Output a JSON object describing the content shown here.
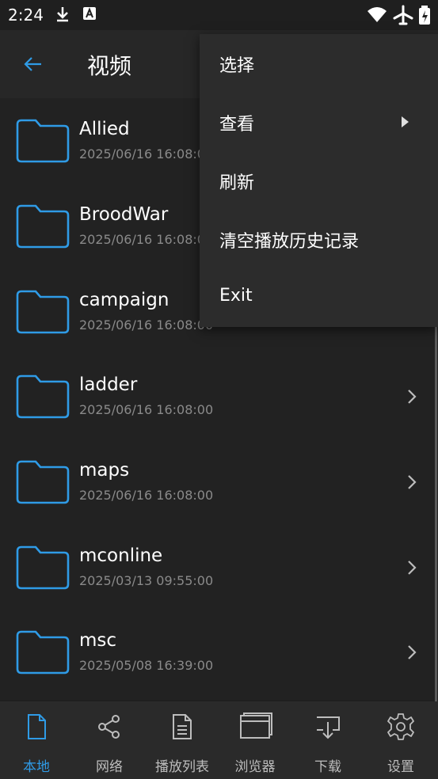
{
  "status_bar": {
    "time": "2:24"
  },
  "header": {
    "title": "视频"
  },
  "files": [
    {
      "name": "Allied",
      "date": "2025/06/16 16:08:00"
    },
    {
      "name": "BroodWar",
      "date": "2025/06/16 16:08:00"
    },
    {
      "name": "campaign",
      "date": "2025/06/16 16:08:00"
    },
    {
      "name": "ladder",
      "date": "2025/06/16 16:08:00"
    },
    {
      "name": "maps",
      "date": "2025/06/16 16:08:00"
    },
    {
      "name": "mconline",
      "date": "2025/03/13 09:55:00"
    },
    {
      "name": "msc",
      "date": "2025/05/08 16:39:00"
    }
  ],
  "menu": {
    "items": [
      {
        "label": "选择"
      },
      {
        "label": "查看"
      },
      {
        "label": "刷新"
      },
      {
        "label": "清空播放历史记录"
      },
      {
        "label": "Exit"
      }
    ]
  },
  "bottom_nav": {
    "items": [
      {
        "label": "本地",
        "icon": "document-icon",
        "active": true
      },
      {
        "label": "网络",
        "icon": "share-icon"
      },
      {
        "label": "播放列表",
        "icon": "playlist-icon"
      },
      {
        "label": "浏览器",
        "icon": "browser-icon"
      },
      {
        "label": "下载",
        "icon": "download-icon"
      },
      {
        "label": "设置",
        "icon": "gear-icon"
      }
    ]
  },
  "colors": {
    "accent": "#2f9be6",
    "background": "#222222",
    "menu": "#2c2c2c",
    "date_text": "#8a8a8a"
  }
}
